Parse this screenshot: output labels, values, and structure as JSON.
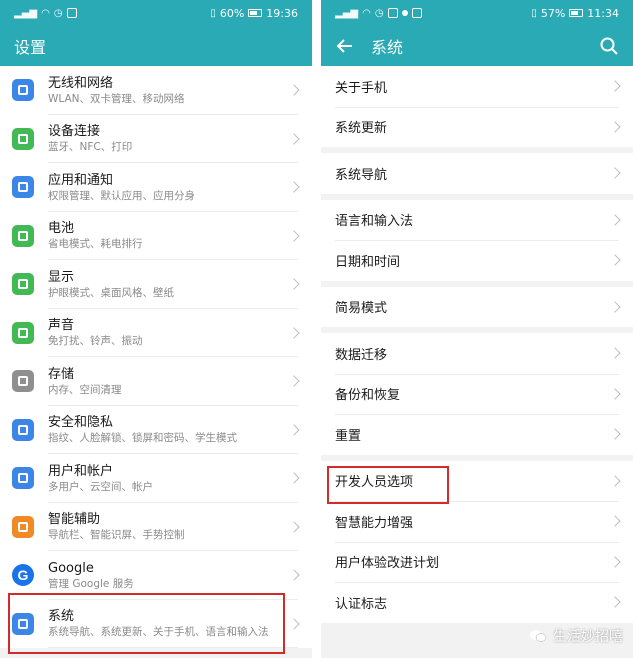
{
  "left": {
    "status": {
      "percent": "60%",
      "time": "19:36"
    },
    "title": "设置",
    "items": [
      {
        "title": "无线和网络",
        "subtitle": "WLAN、双卡管理、移动网络",
        "icon": "wifi-icon",
        "color": "#3b86e6"
      },
      {
        "title": "设备连接",
        "subtitle": "蓝牙、NFC、打印",
        "icon": "device-connect-icon",
        "color": "#43b956"
      },
      {
        "title": "应用和通知",
        "subtitle": "权限管理、默认应用、应用分身",
        "icon": "apps-icon",
        "color": "#3b86e6"
      },
      {
        "title": "电池",
        "subtitle": "省电模式、耗电排行",
        "icon": "battery-icon",
        "color": "#43b956"
      },
      {
        "title": "显示",
        "subtitle": "护眼模式、桌面风格、壁纸",
        "icon": "display-icon",
        "color": "#43b956"
      },
      {
        "title": "声音",
        "subtitle": "免打扰、铃声、振动",
        "icon": "sound-icon",
        "color": "#43b956"
      },
      {
        "title": "存储",
        "subtitle": "内存、空间清理",
        "icon": "storage-icon",
        "color": "#8f8f8f"
      },
      {
        "title": "安全和隐私",
        "subtitle": "指纹、人脸解锁、锁屏和密码、学生模式",
        "icon": "shield-icon",
        "color": "#3b86e6"
      },
      {
        "title": "用户和帐户",
        "subtitle": "多用户、云空间、帐户",
        "icon": "user-icon",
        "color": "#3b86e6"
      },
      {
        "title": "智能辅助",
        "subtitle": "导航栏、智能识屏、手势控制",
        "icon": "hand-icon",
        "color": "#f08a24"
      },
      {
        "title": "Google",
        "subtitle": "管理 Google 服务",
        "icon": "google-icon",
        "color": "#1a73e8"
      },
      {
        "title": "系统",
        "subtitle": "系统导航、系统更新、关于手机、语言和输入法",
        "icon": "system-icon",
        "color": "#3b86e6"
      }
    ]
  },
  "right": {
    "status": {
      "percent": "57%",
      "time": "11:34"
    },
    "title": "系统",
    "groups": [
      [
        "关于手机",
        "系统更新"
      ],
      [
        "系统导航"
      ],
      [
        "语言和输入法",
        "日期和时间"
      ],
      [
        "简易模式"
      ],
      [
        "数据迁移",
        "备份和恢复",
        "重置"
      ],
      [
        "开发人员选项",
        "智慧能力增强",
        "用户体验改进计划",
        "认证标志"
      ]
    ]
  },
  "watermark": "生活妙招嘻",
  "colors": {
    "accent": "#2aaab5",
    "highlight": "#d12b2b"
  }
}
